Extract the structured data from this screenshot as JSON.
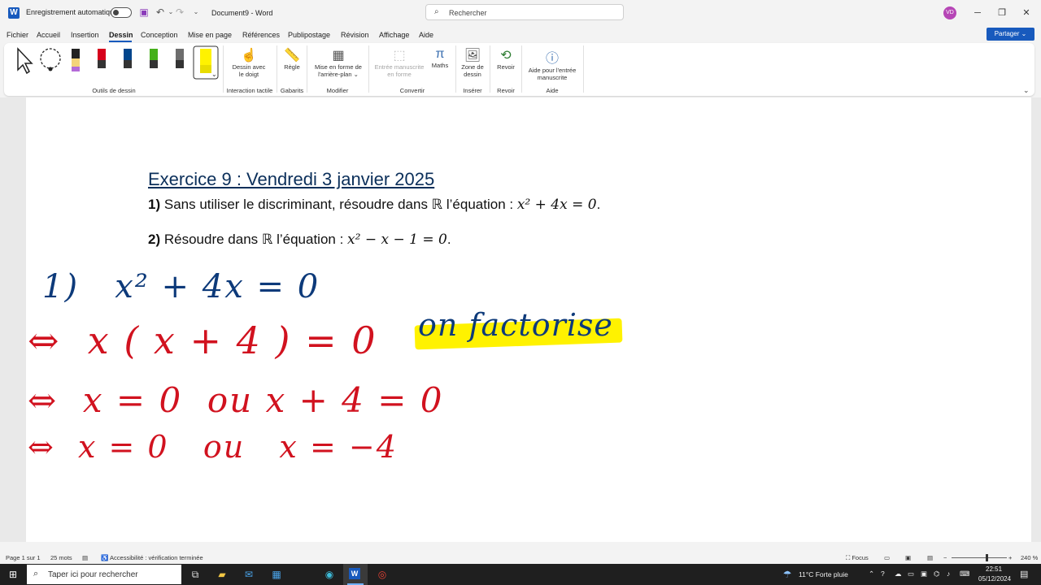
{
  "titlebar": {
    "autosave_label": "Enregistrement automatique",
    "doc_title": "Document9  -  Word",
    "search_placeholder": "Rechercher",
    "avatar_initials": "VD"
  },
  "menu": {
    "tabs": [
      "Fichier",
      "Accueil",
      "Insertion",
      "Dessin",
      "Conception",
      "Mise en page",
      "Références",
      "Publipostage",
      "Révision",
      "Affichage",
      "Aide"
    ],
    "active": "Dessin",
    "share_label": "Partager"
  },
  "ribbon": {
    "buttons": {
      "finger_draw": [
        "Dessin avec",
        "le doigt"
      ],
      "ruler": "Règle",
      "background": [
        "Mise en forme de",
        "l'arrière-plan"
      ],
      "ink_to_shape": [
        "Entrée manuscrite",
        "en forme"
      ],
      "math": "Maths",
      "canvas": [
        "Zone de",
        "dessin"
      ],
      "replay": "Revoir",
      "help": [
        "Aide pour l'entrée",
        "manuscrite"
      ]
    },
    "groups": {
      "drawing_tools": "Outils de dessin",
      "touch": "Interaction tactile",
      "templates": "Gabarits",
      "modify": "Modifier",
      "convert": "Convertir",
      "insert": "Insérer",
      "replay": "Revoir",
      "help": "Aide"
    },
    "pen_colors": [
      "#1a1a1a",
      "#d6001c",
      "#00458c",
      "#45b01a",
      "#6d6d6d",
      "#fff200"
    ]
  },
  "document": {
    "title": "Exercice 9 : Vendredi 3 janvier 2025",
    "q1_num": "1)",
    "q1_text": "Sans utiliser le discriminant, résoudre dans ℝ l’équation : ",
    "q1_math": "x² + 4x = 0",
    "q1_end": ".",
    "q2_num": "2)",
    "q2_text": "Résoudre dans ℝ l’équation : ",
    "q2_math": "x² − x − 1 = 0",
    "q2_end": "."
  },
  "ink": {
    "line1": "1)   x² + 4x = 0",
    "line2": "⇔  x ( x + 4 ) = 0",
    "note": "on factorise",
    "line3": "⇔  x = 0  ou x + 4 = 0",
    "line4": "⇔  x = 0   ou   x = −4",
    "colors": {
      "blue": "#0d3a7a",
      "red": "#d1121f",
      "highlight": "#fff200"
    }
  },
  "statusbar": {
    "page": "Page 1 sur 1",
    "words": "25 mots",
    "accessibility": "Accessibilité : vérification terminée",
    "focus": "Focus",
    "zoom": "240 %"
  },
  "taskbar": {
    "search_placeholder": "Taper ici pour rechercher",
    "weather": "11°C  Forte pluie",
    "time": "22:51",
    "date": "05/12/2024"
  }
}
